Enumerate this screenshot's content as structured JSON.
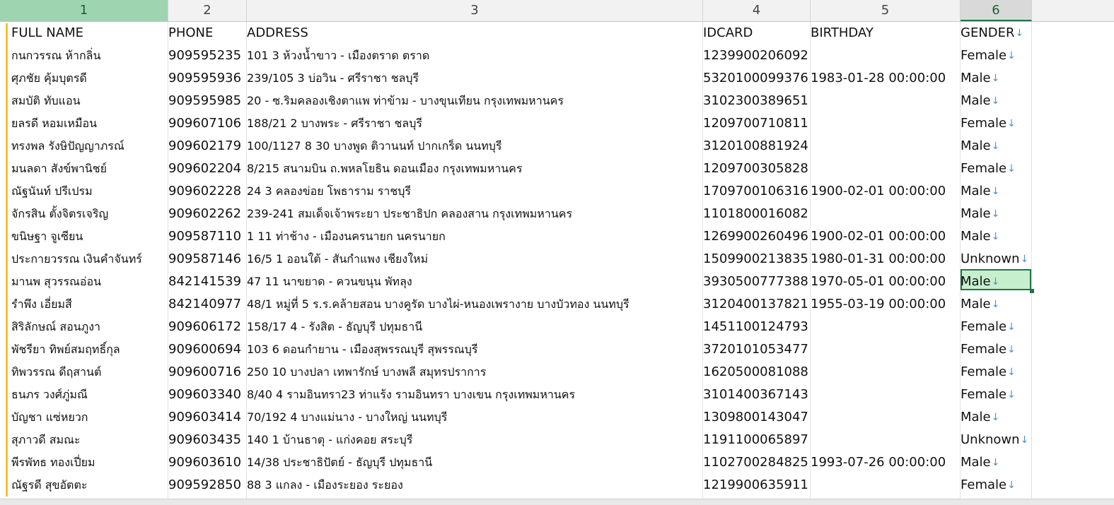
{
  "columns": [
    "1",
    "2",
    "3",
    "4",
    "5",
    "6"
  ],
  "headers": [
    "FULL NAME",
    "PHONE",
    "ADDRESS",
    "IDCARD",
    "BIRTHDAY",
    "GENDER"
  ],
  "rows": [
    [
      "กนกวรรณ ห้ากลิ่น",
      "909595235",
      "101 3  ห้วงน้ำขาว - เมืองตราด ตราด",
      "1239900206092",
      "",
      "Female"
    ],
    [
      "ศุภชัย คุ้มบุตรดี",
      "909595936",
      "239/105 3  บ่อวิน - ศรีราชา ชลบุรี",
      "5320100099376",
      "1983-01-28 00:00:00",
      "Male"
    ],
    [
      "สมบัติ ทับแอน",
      "909595985",
      "20 - ซ.ริมคลองเชิงตาแพ ท่าข้าม - บางขุนเทียน กรุงเทพมหานคร",
      "3102300389651",
      "",
      "Male"
    ],
    [
      "ยลรดี หอมเหมือน",
      "909607106",
      "188/21 2  บางพระ - ศรีราชา ชลบุรี",
      "1209700710811",
      "",
      "Female"
    ],
    [
      "ทรงพล รังษิปัญญาภรณ์",
      "909602179",
      "100/1127 8 30 บางพูด ติวานนท์ ปากเกร็ด นนทบุรี",
      "3120100881924",
      "",
      "Male"
    ],
    [
      "มนลดา สังข์พานิชย์",
      "909602204",
      "8/215   สนามบิน ถ.พหลโยธิน ดอนเมือง กรุงเทพมหานคร",
      "1209700305828",
      "",
      "Female"
    ],
    [
      "ณัฐนันท์ ปรีเปรม",
      "909602228",
      "24 3  คลองข่อย  โพธาราม ราชบุรี",
      "1709700106316",
      "1900-02-01 00:00:00",
      "Male"
    ],
    [
      "จักรสิน ตั้งจิตรเจริญ",
      "909602262",
      "239-241   สมเด็จเจ้าพระยา ประชาธิปก คลองสาน กรุงเทพมหานคร",
      "1101800016082",
      "",
      "Male"
    ],
    [
      "ขนิษฐา จูเซียน",
      "909587110",
      "1 11  ท่าช้าง - เมืองนครนายก นครนายก",
      "1269900260496",
      "1900-02-01 00:00:00",
      "Male"
    ],
    [
      "ประกายวรรณ เงินคำจันทร์",
      "909587146",
      "16/5 1  ออนใต้ - สันกำแพง เชียงใหม่",
      "1509900213835",
      "1980-01-31 00:00:00",
      "Unknown"
    ],
    [
      "มานพ สุวรรณอ่อน",
      "842141539",
      "47 11  นาขยาด - ควนขนุน พัทลุง",
      "3930500777388",
      "1970-05-01 00:00:00",
      "Male"
    ],
    [
      "รำพึง เอี่ยมสี",
      "842140977",
      "48/1 หมู่ที่ 5 ร.ร.คล้ายสอน บางคูรัด บางไผ่-หนองเพรางาย บางบัวทอง นนทบุรี",
      "3120400137821",
      "1955-03-19 00:00:00",
      "Male"
    ],
    [
      "สิริลักษณ์ สอนภูงา",
      "909606172",
      "158/17 4 - รังสิต - ธัญบุรี ปทุมธานี",
      "1451100124793",
      "",
      "Female"
    ],
    [
      "พัชรียา ทิพย์สมฤทธิ์กุล",
      "909600694",
      "103 6  ดอนกำยาน - เมืองสุพรรณบุรี สุพรรณบุรี",
      "3720101053477",
      "",
      "Female"
    ],
    [
      "ทิพวรรณ ดีฤสานต์",
      "909600716",
      "250 10  บางปลา เทพารักษ์ บางพลี สมุทรปราการ",
      "1620500081088",
      "",
      "Female"
    ],
    [
      "ธนภร วงศ์ภู่มณี",
      "909603340",
      "8/40 4 รามอินทรา23 ท่าแร้ง รามอินทรา บางเขน กรุงเทพมหานคร",
      "3101400367143",
      "",
      "Female"
    ],
    [
      "บัญชา แซ่หยวก",
      "909603414",
      "70/192 4  บางแม่นาง - บางใหญ่ นนทบุรี",
      "1309800143047",
      "",
      "Male"
    ],
    [
      "สุภาวดี สมณะ",
      "909603435",
      "140 1  บ้านธาตุ - แก่งคอย สระบุรี",
      "1191100065897",
      "",
      "Unknown"
    ],
    [
      "พีรพัทธ ทองเปี่ยม",
      "909603610",
      "14/38   ประชาธิปัตย์ - ธัญบุรี ปทุมธานี",
      "1102700284825",
      "1993-07-26 00:00:00",
      "Male"
    ],
    [
      "ณัฐรดี สุขอัตตะ",
      "909592850",
      "88 3  แกลง - เมืองระยอง ระยอง",
      "1219900635911",
      "",
      "Female"
    ]
  ],
  "icons": {
    "filter": "down-arrow-icon"
  },
  "colors": {
    "accent": "#217346",
    "selected_fill": "#c6efce",
    "arrow": "#4a90d9"
  }
}
